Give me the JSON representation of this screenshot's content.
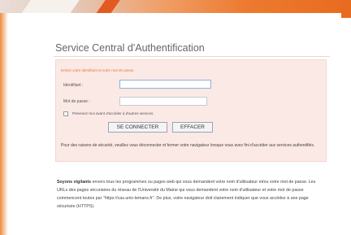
{
  "page": {
    "title": "Service Central d'Authentification"
  },
  "form": {
    "hint": "Entrez votre identifiant et votre mot de passe.",
    "username_label": "Identifiant :",
    "username_value": "",
    "password_label": "Mot de passe :",
    "password_value": "",
    "warn_label": "Prévenez-moi avant d'accéder à d'autres services.",
    "submit_label": "SE CONNECTER",
    "reset_label": "EFFACER",
    "security_note": "Pour des raisons de sécurité, veuillez vous déconnecter et fermer votre navigateur lorsque vous avez fini d'accéder aux services authentifiés."
  },
  "vigilance": {
    "heading": "Soyons vigilants",
    "text": " envers tous les programmes ou pages web qui vous demandent votre nom d'utilisateur et/ou votre mot de passe. Les URLs des pages sécurisées du réseau de l'Université du Maine qui vous demandent votre nom d'utilisateur et votre mot de passe commencent toutes par \"https://cas.univ-lemans.fr\". De plus, votre navigateur doit clairement indiquer que vous accédez à une page sécurisée (HTTPS)."
  },
  "colors": {
    "accent": "#e86b1f",
    "box_background": "#fbe9e6",
    "hint_text": "#e8762c"
  }
}
